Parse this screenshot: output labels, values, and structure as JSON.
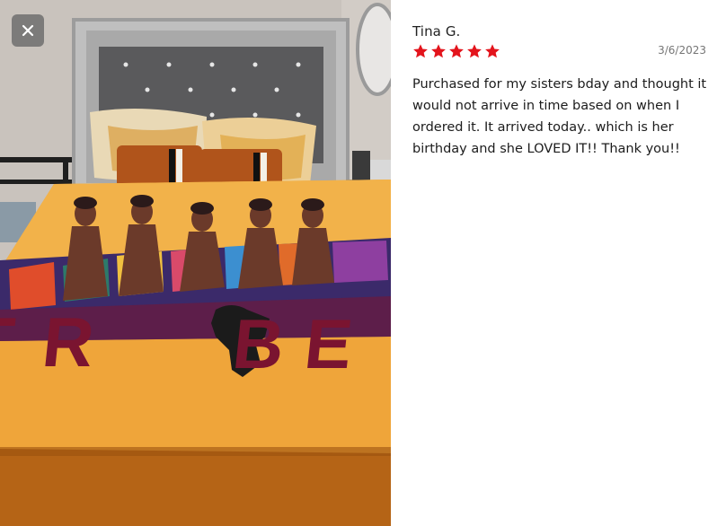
{
  "review": {
    "author": "Tina G.",
    "rating": 5,
    "rating_max": 5,
    "date": "3/6/2023",
    "body": "Purchased for my sisters bday and thought it would not arrive in time based on when I ordered it. It arrived today.. which is her birthday and she LOVED IT!! Thank you!!"
  },
  "photo": {
    "subject": "bed with orange TRIBE blanket",
    "blanket_text": "TR  BE"
  },
  "icons": {
    "close": "close-icon",
    "star": "star-icon"
  },
  "colors": {
    "star": "#e3141c",
    "close_bg": "#6e6e6e",
    "blanket": "#f0a93c",
    "blanket_text": "#7a1430"
  }
}
